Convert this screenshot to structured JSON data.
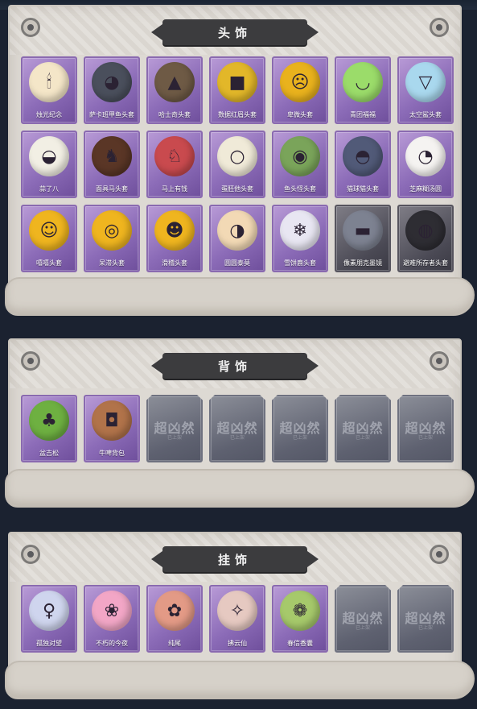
{
  "colors": {
    "card_purple": "#8c6cb8",
    "card_dark": "#4a4954",
    "panel": "#ddd9d3",
    "banner": "#3c3c3e"
  },
  "headwear": {
    "title": "头饰",
    "items": [
      {
        "label": "烛光纪念",
        "icon": "candle-face-icon"
      },
      {
        "label": "萨卡班甲鱼头套",
        "icon": "fish-head-icon"
      },
      {
        "label": "哈士奇头套",
        "icon": "husky-head-icon"
      },
      {
        "label": "数据红眉头套",
        "icon": "yellow-mascot-icon"
      },
      {
        "label": "卑微头套",
        "icon": "sad-face-icon"
      },
      {
        "label": "青团福福",
        "icon": "green-dumpling-icon"
      },
      {
        "label": "太空鲨头套",
        "icon": "shark-head-icon"
      },
      {
        "label": "蒜了八",
        "icon": "garlic-head-icon"
      },
      {
        "label": "面具马头套",
        "icon": "horse-head-icon"
      },
      {
        "label": "马上有钱",
        "icon": "red-horse-icon"
      },
      {
        "label": "蛋胚他头套",
        "icon": "egg-head-icon"
      },
      {
        "label": "鱼头怪头套",
        "icon": "fish-monster-icon"
      },
      {
        "label": "猫球猫头套",
        "icon": "cat-head-icon"
      },
      {
        "label": "芝麻糊汤圆",
        "icon": "dumpling-face-icon"
      },
      {
        "label": "嘻嘻头套",
        "icon": "grin-face-icon"
      },
      {
        "label": "呆滞头套",
        "icon": "stare-face-icon"
      },
      {
        "label": "滑稽头套",
        "icon": "smirk-face-icon"
      },
      {
        "label": "圆圆泰莫",
        "icon": "hamster-head-icon"
      },
      {
        "label": "雪饼鹿头套",
        "icon": "snow-deer-icon"
      },
      {
        "label": "像素朋克墨镜",
        "icon": "pixel-sunglasses-icon"
      },
      {
        "label": "避难所存者头套",
        "icon": "gas-mask-icon"
      }
    ]
  },
  "back": {
    "title": "背饰",
    "items": [
      {
        "label": "盆吉松",
        "icon": "bonsai-icon"
      },
      {
        "label": "牛啤背包",
        "icon": "cow-barrel-icon"
      }
    ],
    "empty_slots": 5,
    "placeholder": "超凶然",
    "placeholder_sub": "已上架"
  },
  "pendant": {
    "title": "挂饰",
    "items": [
      {
        "label": "孤独对望",
        "icon": "doll-pendant-icon"
      },
      {
        "label": "不朽的今夜",
        "icon": "pink-cat-pendant-icon"
      },
      {
        "label": "纯尾",
        "icon": "fox-pendant-icon"
      },
      {
        "label": "拂云仙",
        "icon": "fairy-pendant-icon"
      },
      {
        "label": "春信香囊",
        "icon": "sachet-pendant-icon"
      }
    ],
    "empty_slots": 2,
    "placeholder": "超凶然",
    "placeholder_sub": "已上架"
  }
}
